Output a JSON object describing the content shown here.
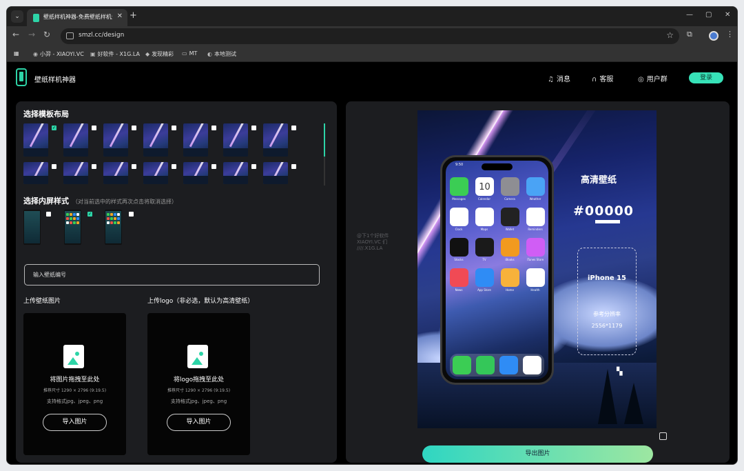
{
  "browser": {
    "tab_title": "壁纸样机神器-免费壁纸样机生",
    "url": "smzl.cc/design",
    "bookmarks": [
      "小羿 - XIAOYI.VC",
      "好软件 - X1G.LA",
      "发现精彩",
      "MT",
      "本地测试"
    ]
  },
  "header": {
    "brand": "壁纸样机神器",
    "nav": [
      {
        "label": "消息",
        "icon": "bell-icon"
      },
      {
        "label": "客服",
        "icon": "headset-icon"
      },
      {
        "label": "用户群",
        "icon": "chat-icon"
      }
    ],
    "login": "登录"
  },
  "left": {
    "layout_title": "选择模板布局",
    "inner_title": "选择内屏样式",
    "inner_hint": "（对当前选中的样式再次点击将取消选择）",
    "code_placeholder": "输入壁纸编号",
    "upload_wall_label": "上传壁纸图片",
    "upload_logo_label": "上传logo（非必选，默认为高清壁纸）",
    "drop_wall": {
      "title": "将图片拖拽至此处",
      "size": "推荐尺寸 1290 × 2796 (9:19.5)",
      "formats": "支持格式jpg、jpeg、png",
      "button": "导入图片"
    },
    "drop_logo": {
      "title": "将logo拖拽至此处",
      "size": "推荐尺寸 1290 × 2796 (9:19.5)",
      "formats": "支持格式jpg、jpeg、png",
      "button": "导入图片"
    },
    "layout_selected": 0,
    "inner_selected": 1
  },
  "preview": {
    "watermark": [
      "@下1个好软件",
      "XIAOYI.VC 们",
      "////.X1G.LA"
    ],
    "title": "高清壁纸",
    "number": "#00000",
    "model": "iPhone 15",
    "res_label": "参考分辨率",
    "resolution": "2556*1179",
    "time": "9:50",
    "apps": [
      "Messages",
      "Calendar",
      "Camera",
      "Weather",
      "Clock",
      "Maps",
      "Wallet",
      "Reminders",
      "Stocks",
      "TV",
      "iBooks",
      "iTunes Store",
      "News",
      "App Store",
      "Home",
      "Health"
    ],
    "calendar_day": "10",
    "export": "导出图片"
  }
}
